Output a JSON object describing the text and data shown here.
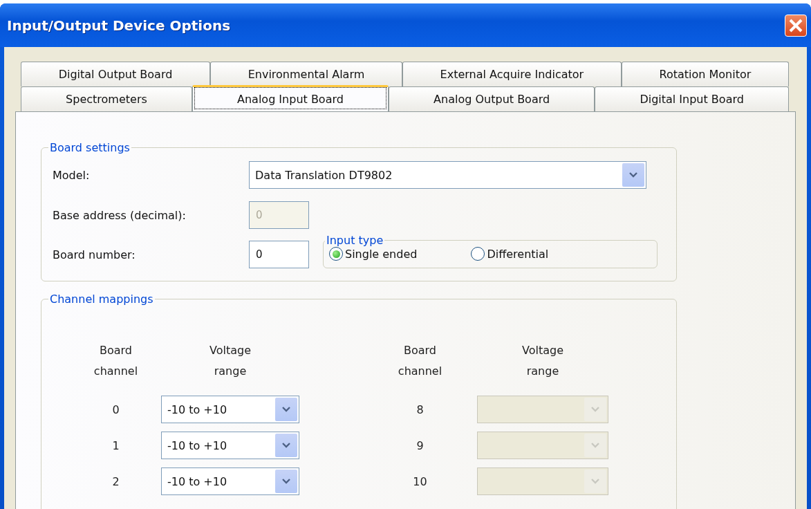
{
  "window": {
    "title": "Input/Output Device Options"
  },
  "tab_rows": [
    {
      "tabs": [
        {
          "label": "Digital Output Board",
          "selected": false
        },
        {
          "label": "Environmental Alarm",
          "selected": false
        },
        {
          "label": "External Acquire Indicator",
          "selected": false
        },
        {
          "label": "Rotation Monitor",
          "selected": false
        }
      ]
    },
    {
      "tabs": [
        {
          "label": "Spectrometers",
          "selected": false
        },
        {
          "label": "Analog Input Board",
          "selected": true
        },
        {
          "label": "Analog Output Board",
          "selected": false
        },
        {
          "label": "Digital Input Board",
          "selected": false
        }
      ]
    }
  ],
  "board_settings": {
    "title": "Board settings",
    "model": {
      "label": "Model:",
      "value": "Data Translation DT9802"
    },
    "base_address": {
      "label": "Base address (decimal):",
      "value": "0",
      "disabled": true
    },
    "board_number": {
      "label": "Board number:",
      "value": "0",
      "disabled": false
    },
    "input_type": {
      "title": "Input type",
      "options": [
        {
          "label": "Single ended",
          "selected": true
        },
        {
          "label": "Differential",
          "selected": false
        }
      ]
    }
  },
  "channel_mappings": {
    "title": "Channel mappings",
    "headers": [
      "Board\nchannel",
      "Voltage\nrange",
      "Board\nchannel",
      "Voltage\nrange"
    ],
    "rows": [
      {
        "left": {
          "channel": "0",
          "range": "-10 to +10",
          "disabled": false
        },
        "right": {
          "channel": "8",
          "disabled": true
        }
      },
      {
        "left": {
          "channel": "1",
          "range": "-10 to +10",
          "disabled": false
        },
        "right": {
          "channel": "9",
          "disabled": true
        }
      },
      {
        "left": {
          "channel": "2",
          "range": "-10 to +10",
          "disabled": false
        },
        "right": {
          "channel": "10",
          "disabled": true
        }
      }
    ]
  }
}
